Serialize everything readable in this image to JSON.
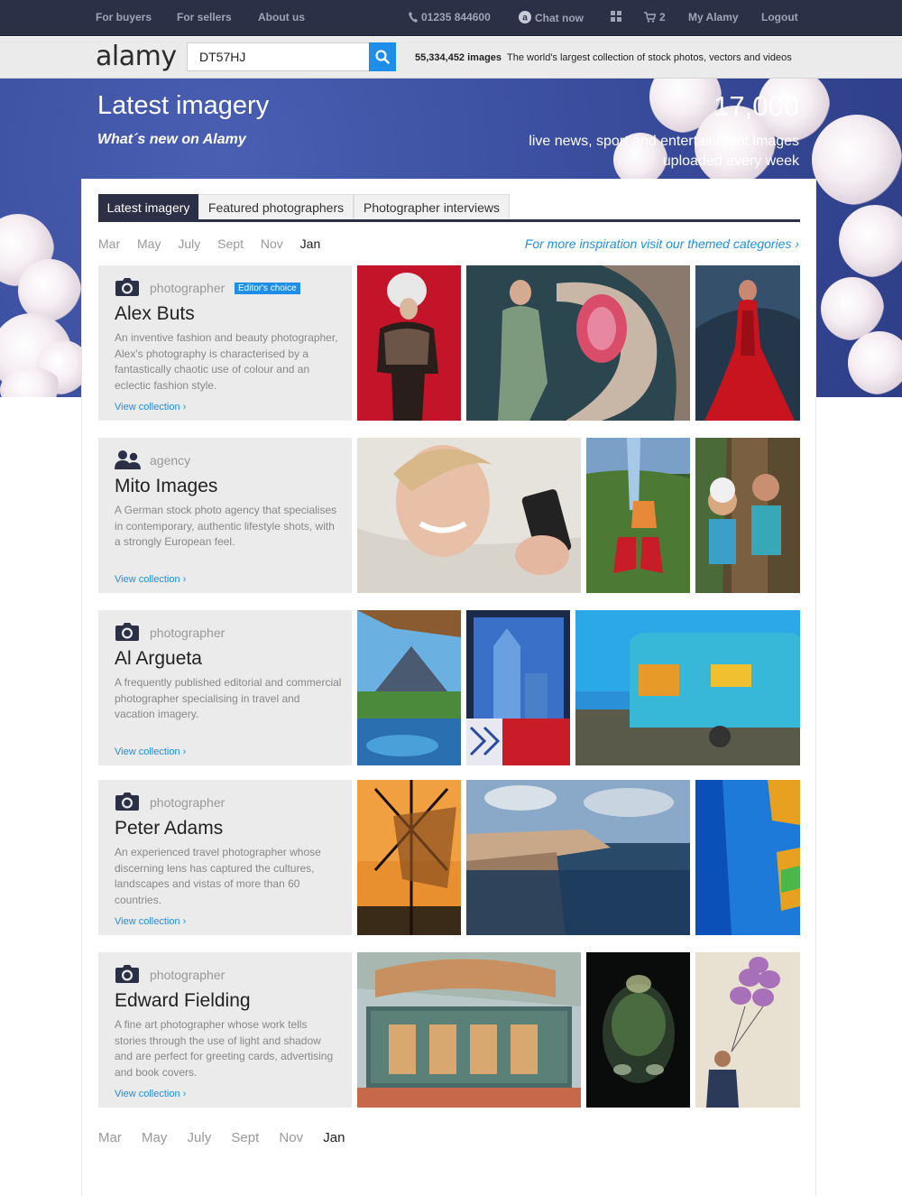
{
  "topnav": {
    "for_buyers": "For buyers",
    "for_sellers": "For sellers",
    "about_us": "About us",
    "phone": "01235 844600",
    "chat": "Chat now",
    "basket_count": "2",
    "my_alamy": "My Alamy",
    "logout": "Logout"
  },
  "header": {
    "logo": "alamy",
    "search_value": "DT57HJ",
    "image_count": "55,334,452 images",
    "tagline": "The world's largest collection of stock photos, vectors and videos"
  },
  "hero": {
    "title": "Latest imagery",
    "subtitle": "What´s new on Alamy",
    "count": "17,000",
    "description": "live news, sport and entertainment images uploaded every week"
  },
  "tabs": [
    "Latest imagery",
    "Featured photographers",
    "Photographer interviews"
  ],
  "months": [
    "Mar",
    "May",
    "July",
    "Sept",
    "Nov",
    "Jan"
  ],
  "selected_month": "Jan",
  "inspiration_link": "For more inspiration visit our themed categories ›",
  "cards": [
    {
      "type": "photographer",
      "badge": "Editor's choice",
      "name": "Alex Buts",
      "description": "An inventive fashion and beauty photographer, Alex's photography is characterised by a fantastically chaotic use of colour and an eclectic fashion style.",
      "link": "View collection ›"
    },
    {
      "type": "agency",
      "name": "Mito Images",
      "description": "A German stock photo agency that specialises in contemporary, authentic lifestyle shots, with a strongly European feel.",
      "link": "View collection ›"
    },
    {
      "type": "photographer",
      "name": "Al Argueta",
      "description": "A frequently published editorial and commercial photographer specialising in travel and vacation imagery.",
      "link": "View collection ›"
    },
    {
      "type": "photographer",
      "name": "Peter Adams",
      "description": "An experienced travel photographer whose discerning lens has captured the cultures, landscapes and vistas of more than 60 countries.",
      "link": "View collection ›"
    },
    {
      "type": "photographer",
      "name": "Edward Fielding",
      "description": "A fine art photographer whose work tells stories through the use of light and shadow and are perfect for greeting cards, advertising and book covers.",
      "link": "View collection ›"
    }
  ],
  "colors": {
    "topbar": "#2b3046",
    "accent_blue": "#1e8ee8",
    "card_bg": "#ebebeb"
  }
}
